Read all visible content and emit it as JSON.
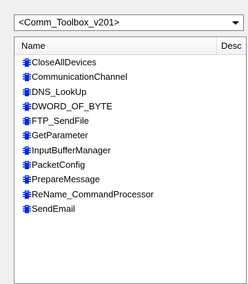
{
  "library_selector": {
    "value": "<Comm_Toolbox_v201>"
  },
  "columns": {
    "name": "Name",
    "description": "Desc"
  },
  "items": [
    "CloseAllDevices",
    "CommunicationChannel",
    "DNS_LookUp",
    "DWORD_OF_BYTE",
    "FTP_SendFile",
    "GetParameter",
    "InputBufferManager",
    "PacketConfig",
    "PrepareMessage",
    "ReName_CommandProcessor",
    "SendEmail"
  ],
  "icon": {
    "name": "function-block-icon",
    "color": "#0a2bd6"
  }
}
